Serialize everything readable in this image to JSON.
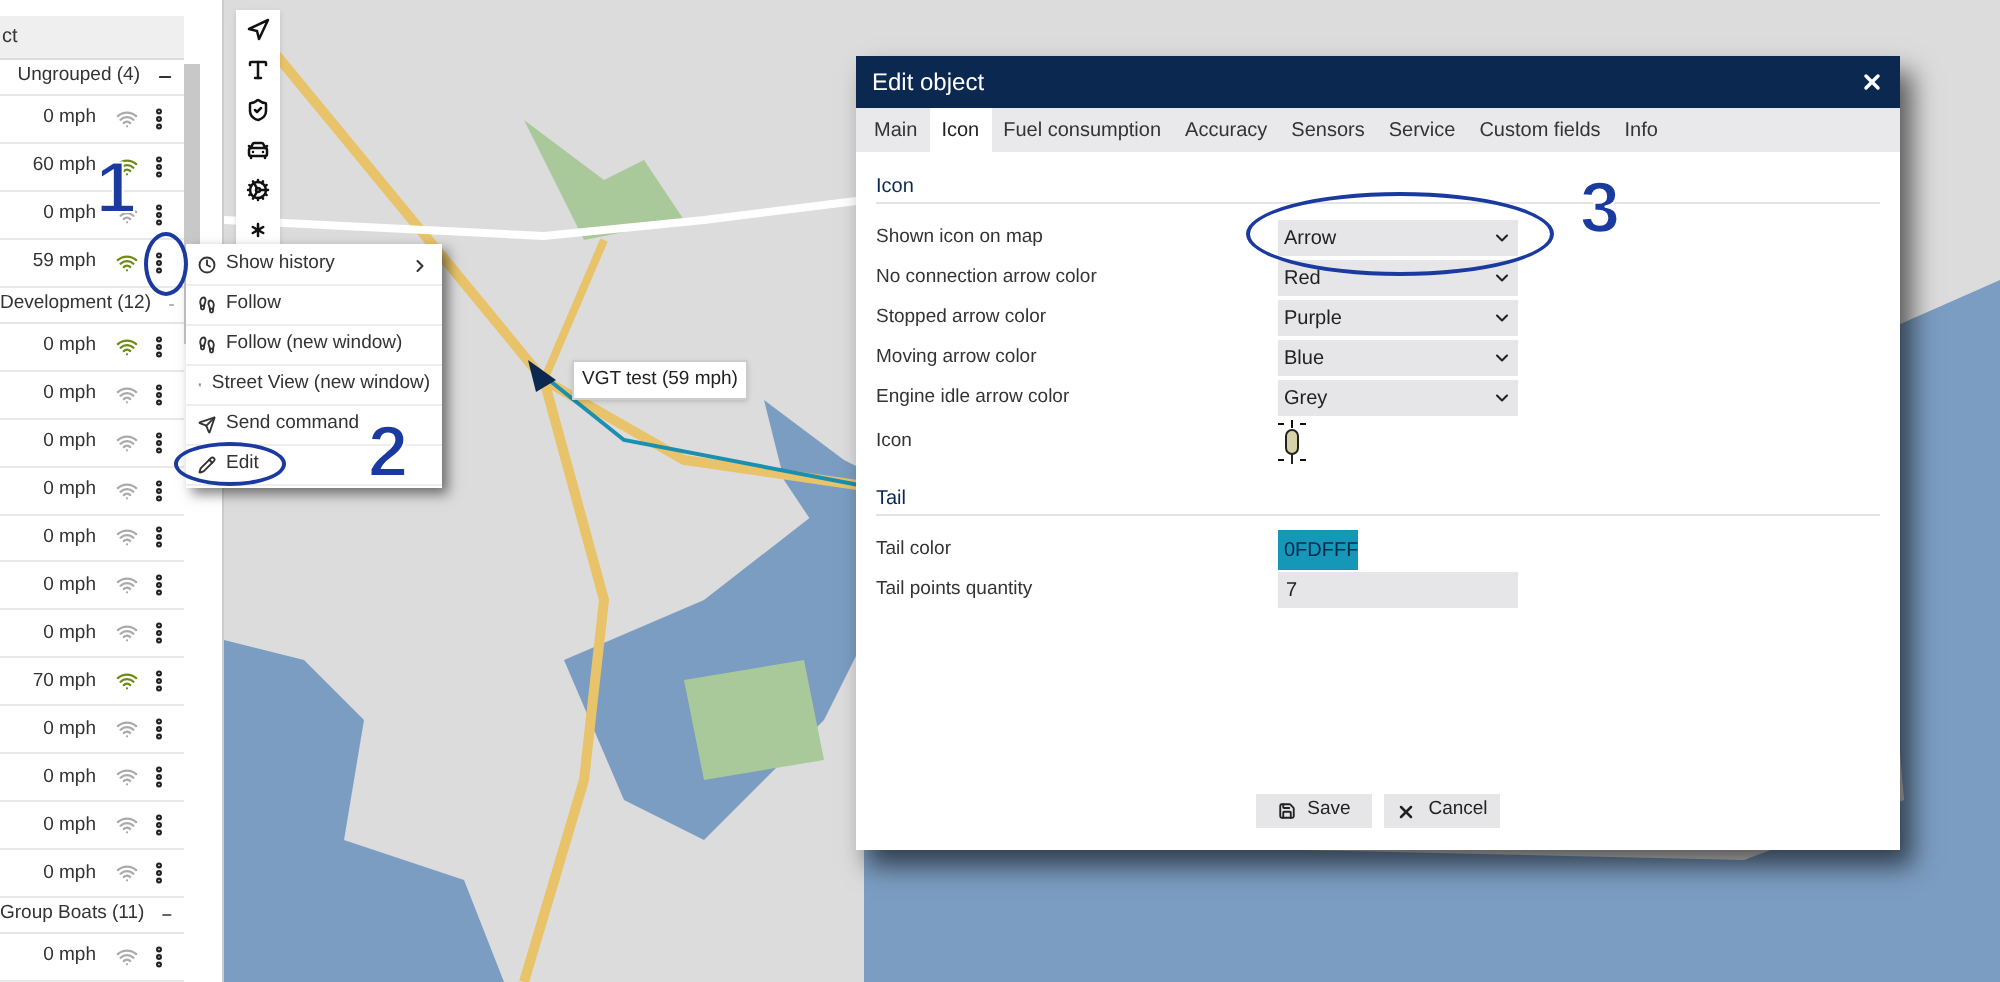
{
  "sidebar": {
    "header": "ct",
    "groups": [
      {
        "name": "Ungrouped (4)",
        "rows": [
          {
            "speed": "0 mph",
            "online": false
          },
          {
            "speed": "60 mph",
            "online": true
          },
          {
            "speed": "0 mph",
            "online": false
          },
          {
            "speed": "59 mph",
            "online": true
          }
        ]
      },
      {
        "name": "Development (12)",
        "rows": [
          {
            "speed": "0 mph",
            "online": true
          },
          {
            "speed": "0 mph",
            "online": false
          },
          {
            "speed": "0 mph",
            "online": false
          },
          {
            "speed": "0 mph",
            "online": false
          },
          {
            "speed": "0 mph",
            "online": false
          },
          {
            "speed": "0 mph",
            "online": false
          },
          {
            "speed": "0 mph",
            "online": false
          },
          {
            "speed": "70 mph",
            "online": true
          },
          {
            "speed": "0 mph",
            "online": false
          },
          {
            "speed": "0 mph",
            "online": false
          },
          {
            "speed": "0 mph",
            "online": false
          },
          {
            "speed": "0 mph",
            "online": false
          }
        ]
      },
      {
        "name": "Group Boats (11)",
        "rows": [
          {
            "speed": "0 mph",
            "online": false
          }
        ]
      }
    ]
  },
  "map": {
    "tooltip": "VGT test (59 mph)"
  },
  "context_menu": {
    "items": [
      {
        "label": "Show history",
        "kind": "submenu"
      },
      {
        "label": "Follow",
        "kind": "action"
      },
      {
        "label": "Follow (new window)",
        "kind": "action"
      },
      {
        "label": "Street View (new window)",
        "kind": "action"
      },
      {
        "label": "Send command",
        "kind": "action"
      },
      {
        "label": "Edit",
        "kind": "action"
      }
    ]
  },
  "dialog": {
    "title": "Edit object",
    "tabs": [
      {
        "label": "Main",
        "selected": false
      },
      {
        "label": "Icon",
        "selected": true
      },
      {
        "label": "Fuel consumption",
        "selected": false
      },
      {
        "label": "Accuracy",
        "selected": false
      },
      {
        "label": "Sensors",
        "selected": false
      },
      {
        "label": "Service",
        "selected": false
      },
      {
        "label": "Custom fields",
        "selected": false
      },
      {
        "label": "Info",
        "selected": false
      }
    ],
    "sections": [
      {
        "title": "Icon",
        "fields": [
          {
            "label": "Shown icon on map",
            "kind": "select",
            "value": "Arrow"
          },
          {
            "label": "No connection arrow color",
            "kind": "select",
            "value": "Red"
          },
          {
            "label": "Stopped arrow color",
            "kind": "select",
            "value": "Purple"
          },
          {
            "label": "Moving arrow color",
            "kind": "select",
            "value": "Blue"
          },
          {
            "label": "Engine idle arrow color",
            "kind": "select",
            "value": "Grey"
          },
          {
            "label": "Icon",
            "kind": "image"
          }
        ]
      },
      {
        "title": "Tail",
        "fields": [
          {
            "label": "Tail color",
            "kind": "color",
            "value": "0FDFFF"
          },
          {
            "label": "Tail points quantity",
            "kind": "text",
            "value": "7"
          }
        ]
      }
    ],
    "buttons": [
      {
        "label": "Save",
        "kind": "save"
      },
      {
        "label": "Cancel",
        "kind": "cancel"
      }
    ]
  },
  "annotations": [
    {
      "label": "1"
    },
    {
      "label": "2"
    },
    {
      "label": "3"
    }
  ]
}
